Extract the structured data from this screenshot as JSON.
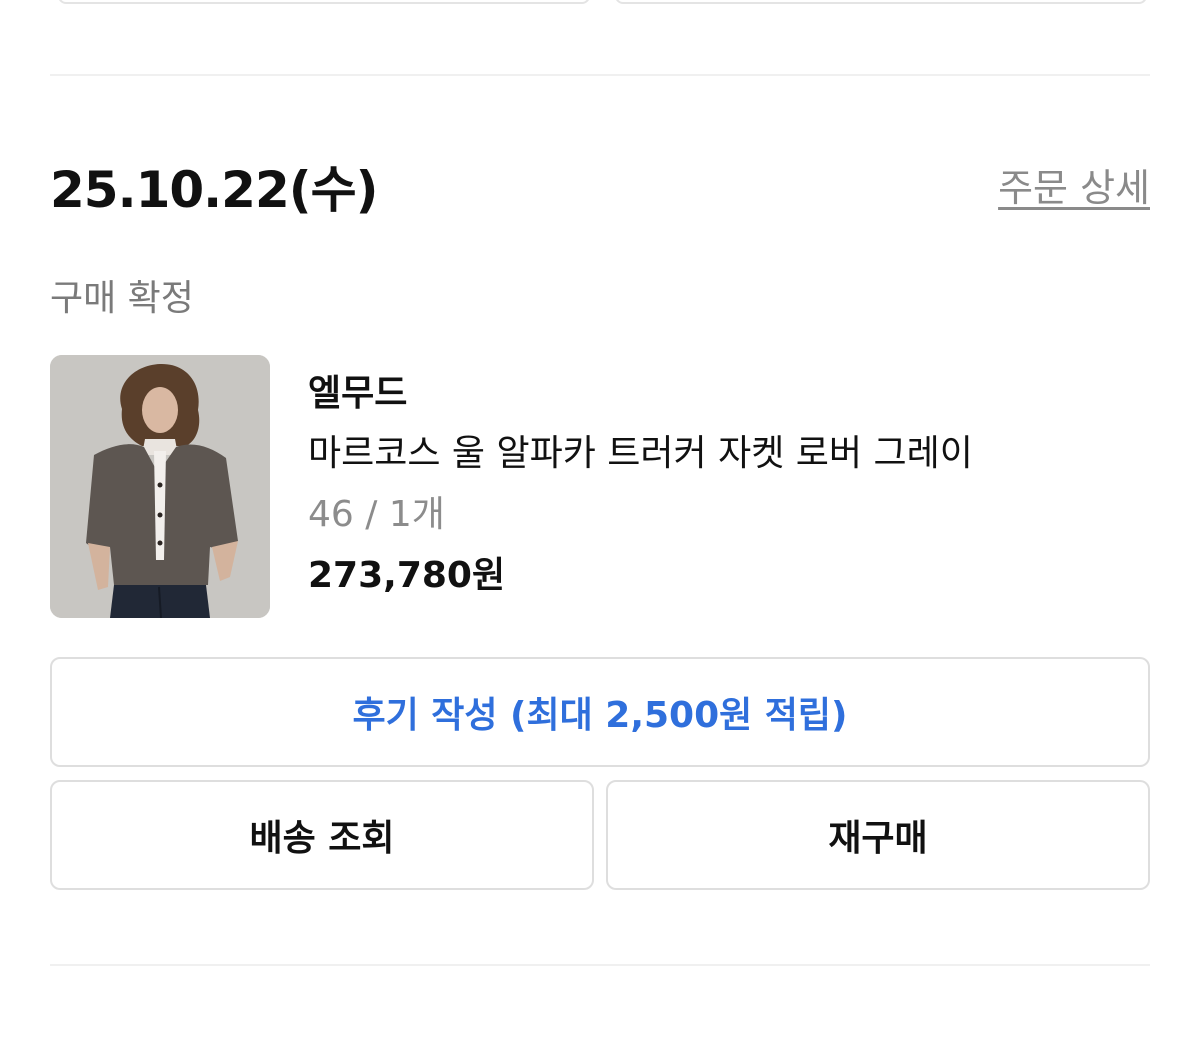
{
  "order": {
    "date": "25.10.22(수)",
    "detail_link": "주문 상세",
    "status": "구매 확정"
  },
  "product": {
    "brand": "엘무드",
    "name": "마르코스 울 알파카 트러커 자켓 로버 그레이",
    "option": "46 / 1개",
    "price": "273,780원"
  },
  "actions": {
    "review": "후기 작성 (최대 2,500원 적립)",
    "delivery": "배송 조회",
    "rebuy": "재구매"
  },
  "colors": {
    "accent": "#2f6fdc",
    "divider": "#f0f0f0",
    "border": "#dedede"
  }
}
